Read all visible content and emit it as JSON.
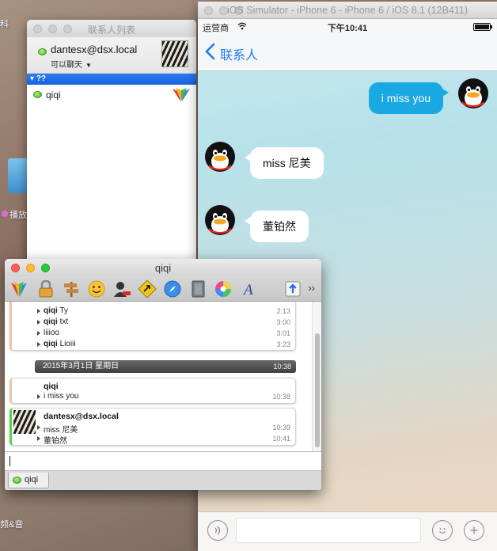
{
  "desktop": {
    "label_top": "科",
    "label_mid": "播放",
    "label_bottom": "频&音"
  },
  "contacts_window": {
    "title": "联系人列表",
    "account_name": "dantesx@dsx.local",
    "account_status": "可以聊天",
    "group_name": "??",
    "contacts": [
      {
        "name": "qiqi"
      }
    ]
  },
  "simulator": {
    "title": "iOS Simulator - iPhone 6 - iPhone 6 / iOS 8.1 (12B411)",
    "carrier": "运营商",
    "time": "下午10:41",
    "back_label": "联系人",
    "messages": [
      {
        "direction": "out",
        "text": "i miss you"
      },
      {
        "direction": "in",
        "text": "miss 尼美"
      },
      {
        "direction": "in",
        "text": "董铂然"
      }
    ]
  },
  "chat_window": {
    "title": "qiqi",
    "history": [
      {
        "sender": "qiqi",
        "text": "Ty",
        "time": "2:13"
      },
      {
        "sender": "qiqi",
        "text": "txt",
        "time": "3:00"
      },
      {
        "sender": "",
        "text": "liiioo",
        "time": "3:01"
      },
      {
        "sender": "qiqi",
        "text": "Lioiii",
        "time": "3:23"
      }
    ],
    "date_banner": "2015年3月1日 星期日",
    "date_banner_time": "10:38",
    "block_them": {
      "sender": "qiqi",
      "lines": [
        {
          "text": "i miss you",
          "time": "10:38"
        }
      ]
    },
    "block_me": {
      "sender": "dantesx@dsx.local",
      "lines": [
        {
          "text": "miss 尼美",
          "time": "10:39"
        },
        {
          "text": "董铂然",
          "time": "10:41"
        }
      ]
    },
    "tab_label": "qiqi",
    "toolbar_more": "››"
  }
}
